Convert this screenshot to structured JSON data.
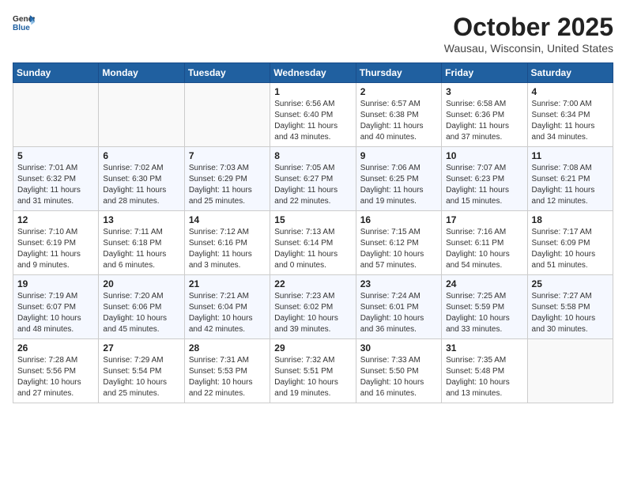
{
  "header": {
    "logo_general": "General",
    "logo_blue": "Blue",
    "month": "October 2025",
    "location": "Wausau, Wisconsin, United States"
  },
  "days_of_week": [
    "Sunday",
    "Monday",
    "Tuesday",
    "Wednesday",
    "Thursday",
    "Friday",
    "Saturday"
  ],
  "weeks": [
    [
      {
        "day": "",
        "sunrise": "",
        "sunset": "",
        "daylight": ""
      },
      {
        "day": "",
        "sunrise": "",
        "sunset": "",
        "daylight": ""
      },
      {
        "day": "",
        "sunrise": "",
        "sunset": "",
        "daylight": ""
      },
      {
        "day": "1",
        "sunrise": "Sunrise: 6:56 AM",
        "sunset": "Sunset: 6:40 PM",
        "daylight": "Daylight: 11 hours and 43 minutes."
      },
      {
        "day": "2",
        "sunrise": "Sunrise: 6:57 AM",
        "sunset": "Sunset: 6:38 PM",
        "daylight": "Daylight: 11 hours and 40 minutes."
      },
      {
        "day": "3",
        "sunrise": "Sunrise: 6:58 AM",
        "sunset": "Sunset: 6:36 PM",
        "daylight": "Daylight: 11 hours and 37 minutes."
      },
      {
        "day": "4",
        "sunrise": "Sunrise: 7:00 AM",
        "sunset": "Sunset: 6:34 PM",
        "daylight": "Daylight: 11 hours and 34 minutes."
      }
    ],
    [
      {
        "day": "5",
        "sunrise": "Sunrise: 7:01 AM",
        "sunset": "Sunset: 6:32 PM",
        "daylight": "Daylight: 11 hours and 31 minutes."
      },
      {
        "day": "6",
        "sunrise": "Sunrise: 7:02 AM",
        "sunset": "Sunset: 6:30 PM",
        "daylight": "Daylight: 11 hours and 28 minutes."
      },
      {
        "day": "7",
        "sunrise": "Sunrise: 7:03 AM",
        "sunset": "Sunset: 6:29 PM",
        "daylight": "Daylight: 11 hours and 25 minutes."
      },
      {
        "day": "8",
        "sunrise": "Sunrise: 7:05 AM",
        "sunset": "Sunset: 6:27 PM",
        "daylight": "Daylight: 11 hours and 22 minutes."
      },
      {
        "day": "9",
        "sunrise": "Sunrise: 7:06 AM",
        "sunset": "Sunset: 6:25 PM",
        "daylight": "Daylight: 11 hours and 19 minutes."
      },
      {
        "day": "10",
        "sunrise": "Sunrise: 7:07 AM",
        "sunset": "Sunset: 6:23 PM",
        "daylight": "Daylight: 11 hours and 15 minutes."
      },
      {
        "day": "11",
        "sunrise": "Sunrise: 7:08 AM",
        "sunset": "Sunset: 6:21 PM",
        "daylight": "Daylight: 11 hours and 12 minutes."
      }
    ],
    [
      {
        "day": "12",
        "sunrise": "Sunrise: 7:10 AM",
        "sunset": "Sunset: 6:19 PM",
        "daylight": "Daylight: 11 hours and 9 minutes."
      },
      {
        "day": "13",
        "sunrise": "Sunrise: 7:11 AM",
        "sunset": "Sunset: 6:18 PM",
        "daylight": "Daylight: 11 hours and 6 minutes."
      },
      {
        "day": "14",
        "sunrise": "Sunrise: 7:12 AM",
        "sunset": "Sunset: 6:16 PM",
        "daylight": "Daylight: 11 hours and 3 minutes."
      },
      {
        "day": "15",
        "sunrise": "Sunrise: 7:13 AM",
        "sunset": "Sunset: 6:14 PM",
        "daylight": "Daylight: 11 hours and 0 minutes."
      },
      {
        "day": "16",
        "sunrise": "Sunrise: 7:15 AM",
        "sunset": "Sunset: 6:12 PM",
        "daylight": "Daylight: 10 hours and 57 minutes."
      },
      {
        "day": "17",
        "sunrise": "Sunrise: 7:16 AM",
        "sunset": "Sunset: 6:11 PM",
        "daylight": "Daylight: 10 hours and 54 minutes."
      },
      {
        "day": "18",
        "sunrise": "Sunrise: 7:17 AM",
        "sunset": "Sunset: 6:09 PM",
        "daylight": "Daylight: 10 hours and 51 minutes."
      }
    ],
    [
      {
        "day": "19",
        "sunrise": "Sunrise: 7:19 AM",
        "sunset": "Sunset: 6:07 PM",
        "daylight": "Daylight: 10 hours and 48 minutes."
      },
      {
        "day": "20",
        "sunrise": "Sunrise: 7:20 AM",
        "sunset": "Sunset: 6:06 PM",
        "daylight": "Daylight: 10 hours and 45 minutes."
      },
      {
        "day": "21",
        "sunrise": "Sunrise: 7:21 AM",
        "sunset": "Sunset: 6:04 PM",
        "daylight": "Daylight: 10 hours and 42 minutes."
      },
      {
        "day": "22",
        "sunrise": "Sunrise: 7:23 AM",
        "sunset": "Sunset: 6:02 PM",
        "daylight": "Daylight: 10 hours and 39 minutes."
      },
      {
        "day": "23",
        "sunrise": "Sunrise: 7:24 AM",
        "sunset": "Sunset: 6:01 PM",
        "daylight": "Daylight: 10 hours and 36 minutes."
      },
      {
        "day": "24",
        "sunrise": "Sunrise: 7:25 AM",
        "sunset": "Sunset: 5:59 PM",
        "daylight": "Daylight: 10 hours and 33 minutes."
      },
      {
        "day": "25",
        "sunrise": "Sunrise: 7:27 AM",
        "sunset": "Sunset: 5:58 PM",
        "daylight": "Daylight: 10 hours and 30 minutes."
      }
    ],
    [
      {
        "day": "26",
        "sunrise": "Sunrise: 7:28 AM",
        "sunset": "Sunset: 5:56 PM",
        "daylight": "Daylight: 10 hours and 27 minutes."
      },
      {
        "day": "27",
        "sunrise": "Sunrise: 7:29 AM",
        "sunset": "Sunset: 5:54 PM",
        "daylight": "Daylight: 10 hours and 25 minutes."
      },
      {
        "day": "28",
        "sunrise": "Sunrise: 7:31 AM",
        "sunset": "Sunset: 5:53 PM",
        "daylight": "Daylight: 10 hours and 22 minutes."
      },
      {
        "day": "29",
        "sunrise": "Sunrise: 7:32 AM",
        "sunset": "Sunset: 5:51 PM",
        "daylight": "Daylight: 10 hours and 19 minutes."
      },
      {
        "day": "30",
        "sunrise": "Sunrise: 7:33 AM",
        "sunset": "Sunset: 5:50 PM",
        "daylight": "Daylight: 10 hours and 16 minutes."
      },
      {
        "day": "31",
        "sunrise": "Sunrise: 7:35 AM",
        "sunset": "Sunset: 5:48 PM",
        "daylight": "Daylight: 10 hours and 13 minutes."
      },
      {
        "day": "",
        "sunrise": "",
        "sunset": "",
        "daylight": ""
      }
    ]
  ]
}
